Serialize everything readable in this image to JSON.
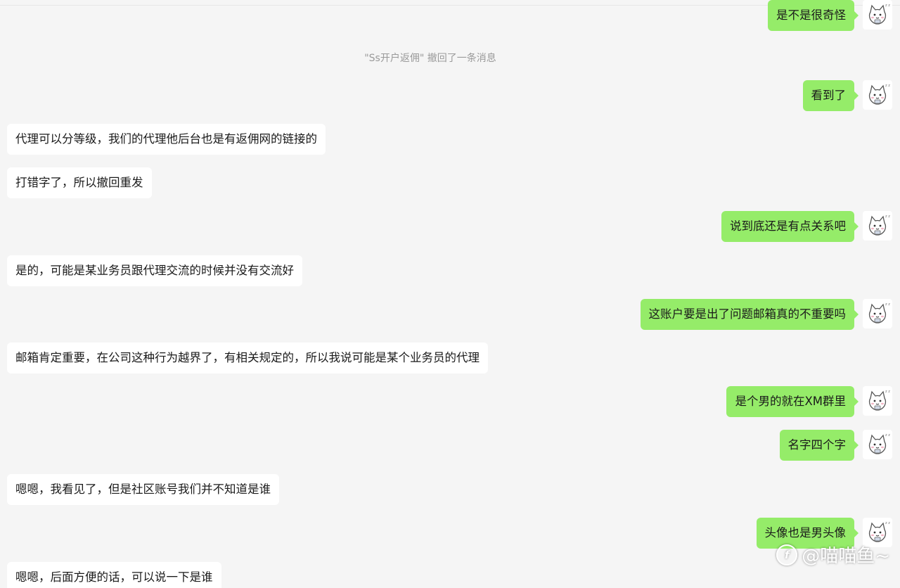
{
  "system_notice": "\"Ss开户返佣\" 撤回了一条消息",
  "messages": [
    {
      "side": "out",
      "text": "是不是很奇怪"
    },
    {
      "side": "out",
      "text": "看到了"
    },
    {
      "side": "in",
      "text": "代理可以分等级，我们的代理他后台也是有返佣网的链接的"
    },
    {
      "side": "in",
      "text": "打错字了，所以撤回重发"
    },
    {
      "side": "out",
      "text": "说到底还是有点关系吧"
    },
    {
      "side": "in",
      "text": "是的，可能是某业务员跟代理交流的时候并没有交流好"
    },
    {
      "side": "out",
      "text": "这账户要是出了问题邮箱真的不重要吗"
    },
    {
      "side": "in",
      "text": "邮箱肯定重要，在公司这种行为越界了，有相关规定的，所以我说可能是某个业务员的代理"
    },
    {
      "side": "out",
      "text": "是个男的就在XM群里"
    },
    {
      "side": "out",
      "text": "名字四个字"
    },
    {
      "side": "in",
      "text": "嗯嗯，我看见了，但是社区账号我们并不知道是谁"
    },
    {
      "side": "out",
      "text": "头像也是男头像"
    },
    {
      "side": "in",
      "text": "嗯嗯，后面方便的话，可以说一下是谁"
    }
  ],
  "avatar_icon": "cat-avatar-icon",
  "watermark": {
    "logo": "f",
    "text": "@喵喵鱼~"
  },
  "colors": {
    "background": "#f5f5f5",
    "outgoing": "#95ec69",
    "incoming": "#ffffff",
    "system_text": "#9a9a9a"
  }
}
